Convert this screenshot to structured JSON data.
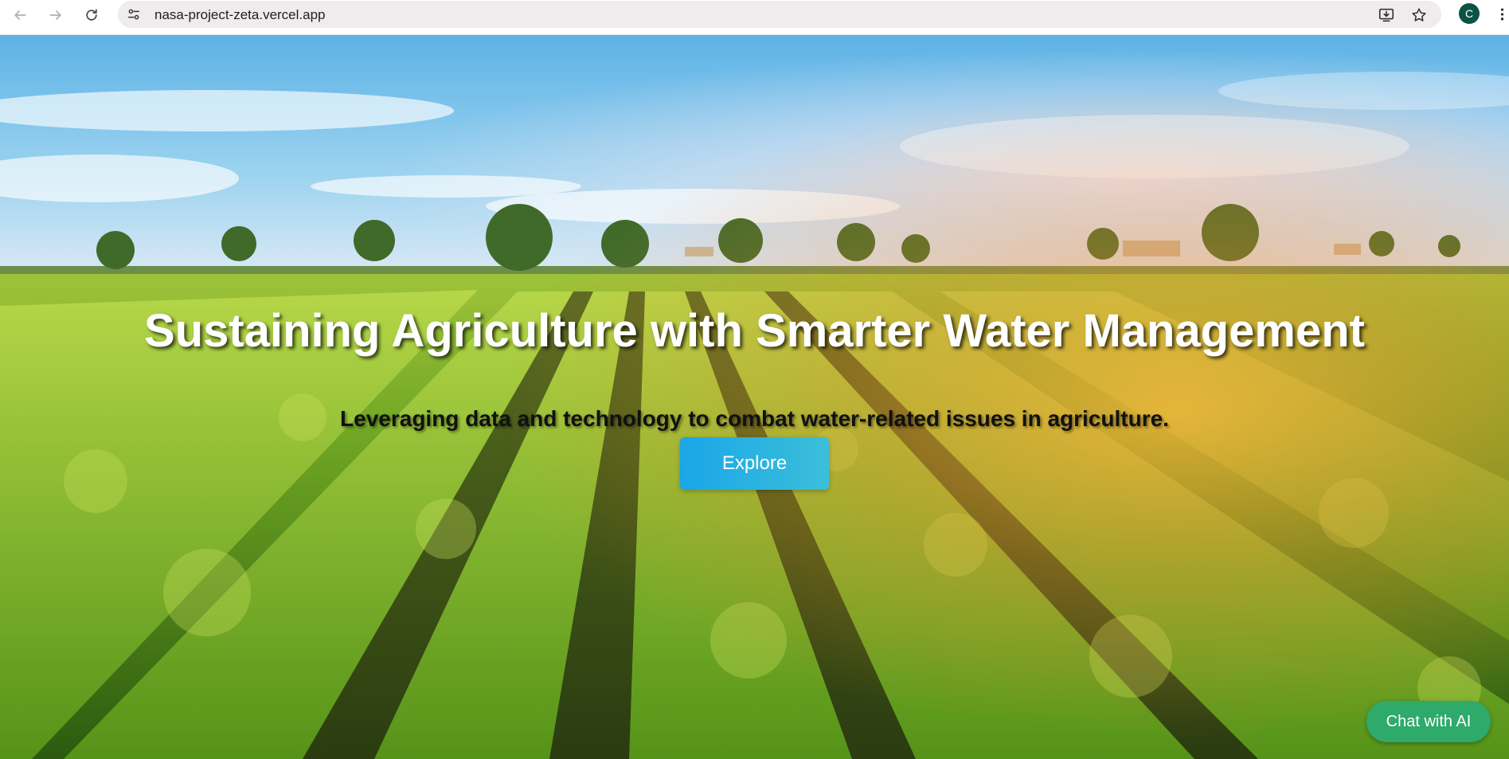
{
  "browser": {
    "url": "nasa-project-zeta.vercel.app",
    "avatar_letter": "C",
    "icons": {
      "back": "arrow-left-icon",
      "forward": "arrow-right-icon",
      "reload": "reload-icon",
      "site_info": "tune-icon",
      "install": "install-app-icon",
      "bookmark": "star-icon",
      "menu": "more-vert-icon"
    }
  },
  "hero": {
    "title": "Sustaining Agriculture with Smarter Water Management",
    "subtitle": "Leveraging data and technology to combat water-related issues in agriculture.",
    "cta_label": "Explore"
  },
  "chat": {
    "label": "Chat with AI"
  },
  "colors": {
    "cta_gradient_start": "#1aa6e8",
    "cta_gradient_end": "#3bbfd9",
    "chat_button": "#2eaa6a",
    "avatar": "#0b5345"
  }
}
